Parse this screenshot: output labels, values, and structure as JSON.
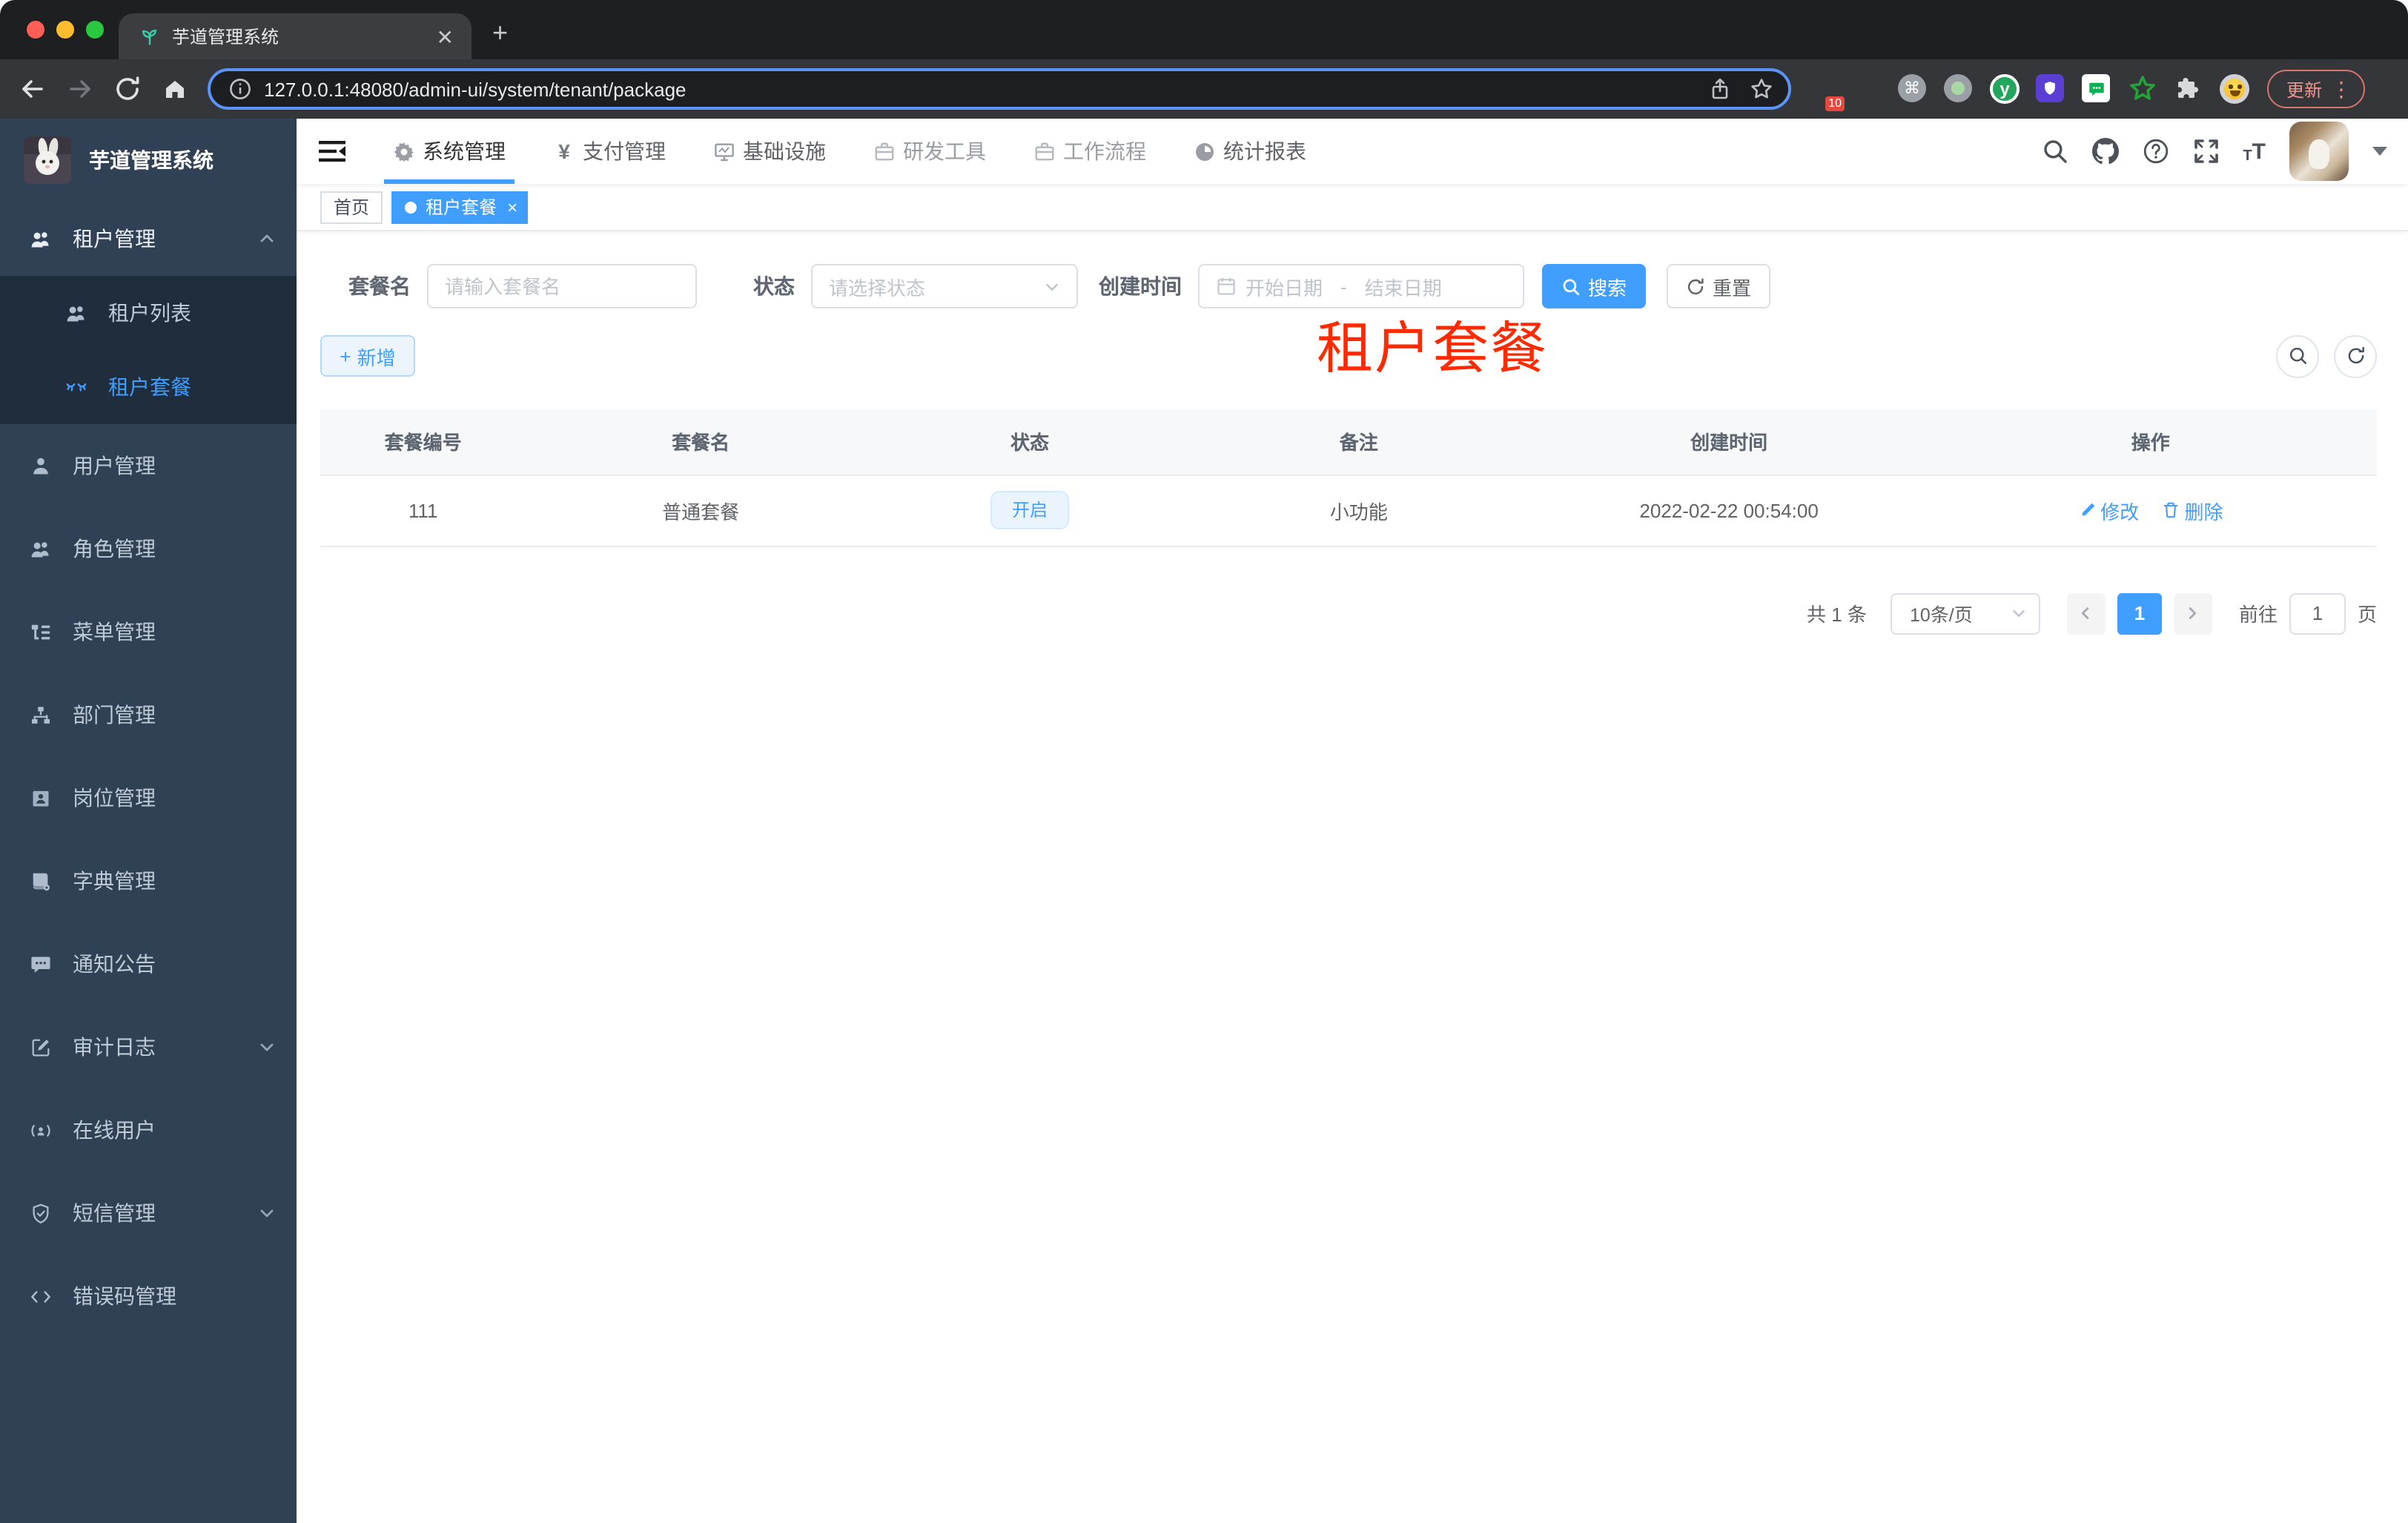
{
  "browser": {
    "tab_title": "芋道管理系统",
    "tab_close_glyph": "✕",
    "new_tab_glyph": "+",
    "url": "127.0.0.1:48080/admin-ui/system/tenant/package",
    "extension_badge": "10",
    "extension_cmd_glyph": "⌘",
    "extension_y_glyph": "y",
    "update_label": "更新",
    "menu_glyph": "⋮"
  },
  "sidebar": {
    "title": "芋道管理系统",
    "items": [
      {
        "label": "租户管理",
        "icon": "users-icon",
        "type": "group-expanded"
      },
      {
        "label": "租户列表",
        "icon": "users-icon",
        "type": "sub"
      },
      {
        "label": "租户套餐",
        "icon": "package-icon",
        "type": "sub-active"
      },
      {
        "label": "用户管理",
        "icon": "user-icon",
        "type": "root"
      },
      {
        "label": "角色管理",
        "icon": "users-icon",
        "type": "root"
      },
      {
        "label": "菜单管理",
        "icon": "menu-tree-icon",
        "type": "root"
      },
      {
        "label": "部门管理",
        "icon": "org-chart-icon",
        "type": "root"
      },
      {
        "label": "岗位管理",
        "icon": "id-badge-icon",
        "type": "root"
      },
      {
        "label": "字典管理",
        "icon": "dictionary-icon",
        "type": "root"
      },
      {
        "label": "通知公告",
        "icon": "message-icon",
        "type": "root"
      },
      {
        "label": "审计日志",
        "icon": "edit-log-icon",
        "type": "group-collapsed"
      },
      {
        "label": "在线用户",
        "icon": "online-user-icon",
        "type": "root"
      },
      {
        "label": "短信管理",
        "icon": "shield-check-icon",
        "type": "group-collapsed"
      },
      {
        "label": "错误码管理",
        "icon": "code-icon",
        "type": "root"
      }
    ]
  },
  "topnav": {
    "items": [
      {
        "label": "系统管理",
        "icon": "gear-icon",
        "active": true
      },
      {
        "label": "支付管理",
        "icon": "yen-icon",
        "active": false
      },
      {
        "label": "基础设施",
        "icon": "monitor-icon",
        "active": false
      },
      {
        "label": "研发工具",
        "icon": "briefcase-icon",
        "active": false
      },
      {
        "label": "工作流程",
        "icon": "briefcase-icon",
        "active": false
      },
      {
        "label": "统计报表",
        "icon": "gauge-icon",
        "active": false
      }
    ]
  },
  "tags": {
    "home_label": "首页",
    "active_label": "租户套餐",
    "close_glyph": "×"
  },
  "annotation": {
    "text": "租户套餐",
    "color": "#ff2a00"
  },
  "filter": {
    "name_label": "套餐名",
    "name_placeholder": "请输入套餐名",
    "status_label": "状态",
    "status_placeholder": "请选择状态",
    "time_label": "创建时间",
    "start_placeholder": "开始日期",
    "range_separator": "-",
    "end_placeholder": "结束日期",
    "search_label": "搜索",
    "reset_label": "重置"
  },
  "actions": {
    "add_label": "新增",
    "plus_glyph": "+"
  },
  "table": {
    "headers": [
      "套餐编号",
      "套餐名",
      "状态",
      "备注",
      "创建时间",
      "操作"
    ],
    "rows": [
      {
        "id": "111",
        "name": "普通套餐",
        "status": "开启",
        "remark": "小功能",
        "created": "2022-02-22 00:54:00",
        "edit_label": "修改",
        "delete_label": "删除"
      }
    ]
  },
  "pagination": {
    "total": "共 1 条",
    "page_size": "10条/页",
    "current_page": "1",
    "goto_label": "前往",
    "goto_value": "1",
    "page_suffix": "页"
  },
  "colors": {
    "primary": "#409eff",
    "sidebar_bg": "#304156",
    "submenu_bg": "#1f2d3d",
    "annotation_red": "#ff2a00"
  }
}
